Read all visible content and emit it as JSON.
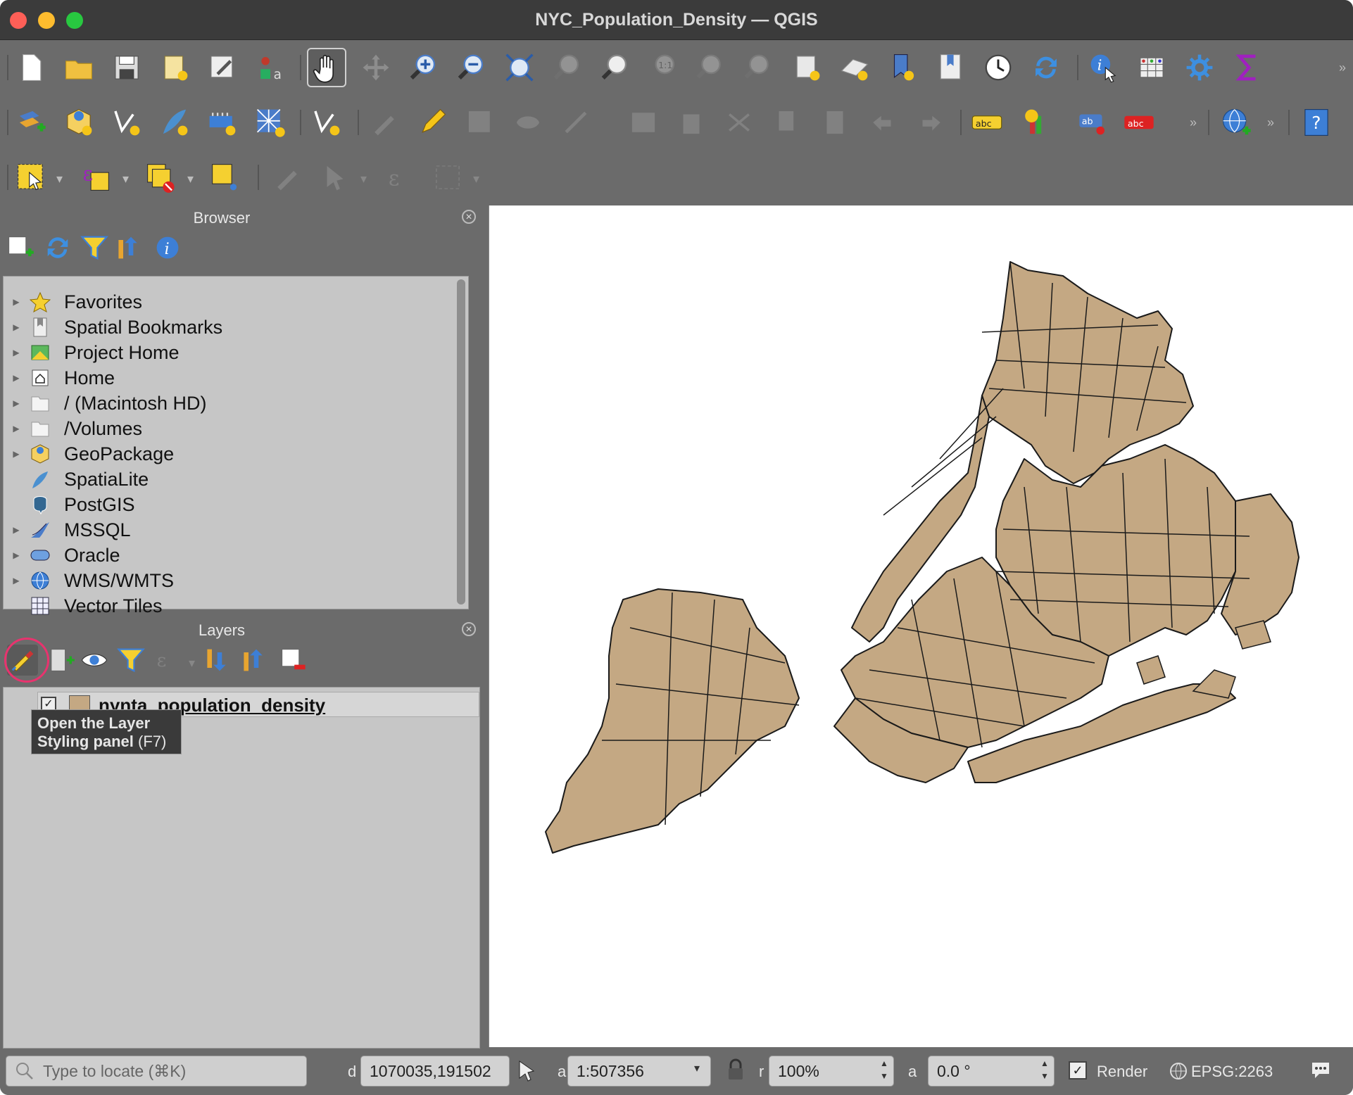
{
  "window": {
    "title": "NYC_Population_Density — QGIS"
  },
  "toolbar1": {
    "icons": [
      "new-project",
      "open-project",
      "save-project",
      "new-print-layout",
      "style-manager",
      "layer-props",
      "pan",
      "pan-to-selection",
      "zoom-in",
      "zoom-out",
      "zoom-full",
      "zoom-selection",
      "zoom-layer",
      "zoom-native",
      "zoom-last",
      "zoom-next",
      "new-map-view",
      "new-3d-view",
      "new-bookmark",
      "show-bookmarks",
      "temporal",
      "refresh",
      "identify",
      "attribute-table",
      "settings",
      "statistics"
    ]
  },
  "toolbar2": {
    "icons": [
      "data-source-manager",
      "new-geopackage",
      "new-shapefile",
      "new-spatialite",
      "new-virtual",
      "new-mesh",
      "digitize",
      "toggle-edit",
      "save-edits",
      "add-feature",
      "vertex-tool",
      "modify-attributes",
      "delete",
      "cut",
      "copy",
      "paste",
      "undo",
      "redo",
      "label",
      "diagram",
      "pin-label",
      "highlight-label",
      "metasearch",
      "help"
    ]
  },
  "browser": {
    "title": "Browser",
    "items": [
      {
        "label": "Favorites",
        "icon": "star-icon",
        "arrow": true
      },
      {
        "label": "Spatial Bookmarks",
        "icon": "bookmark-icon",
        "arrow": true
      },
      {
        "label": "Project Home",
        "icon": "project-home-icon",
        "arrow": true
      },
      {
        "label": "Home",
        "icon": "home-icon",
        "arrow": true
      },
      {
        "label": "/ (Macintosh HD)",
        "icon": "folder-icon",
        "arrow": true
      },
      {
        "label": "/Volumes",
        "icon": "folder-icon",
        "arrow": true
      },
      {
        "label": "GeoPackage",
        "icon": "geopackage-icon",
        "arrow": true
      },
      {
        "label": "SpatiaLite",
        "icon": "spatialite-icon",
        "arrow": false
      },
      {
        "label": "PostGIS",
        "icon": "postgis-icon",
        "arrow": false
      },
      {
        "label": "MSSQL",
        "icon": "mssql-icon",
        "arrow": true
      },
      {
        "label": "Oracle",
        "icon": "oracle-icon",
        "arrow": true
      },
      {
        "label": "WMS/WMTS",
        "icon": "wms-icon",
        "arrow": true
      },
      {
        "label": "Vector Tiles",
        "icon": "vector-tiles-icon",
        "arrow": false
      }
    ]
  },
  "layers": {
    "title": "Layers",
    "layer_name": "nynta_population_density",
    "tooltip_bold": "Open the Layer Styling panel",
    "tooltip_shortcut": "(F7)",
    "swatch_color": "#c4a883"
  },
  "status": {
    "search_placeholder": "Type to locate (⌘K)",
    "coordinate_label": "d",
    "coordinate": "1070035,191502",
    "scale_label": "a",
    "scale": "1:507356",
    "magnifier_label": "r",
    "magnifier": "100%",
    "rotation_label": "a",
    "rotation": "0.0 °",
    "render_label": "Render",
    "crs": "EPSG:2263"
  },
  "colors": {
    "polygon_fill": "#c4a883",
    "highlight": "#e8336e"
  }
}
